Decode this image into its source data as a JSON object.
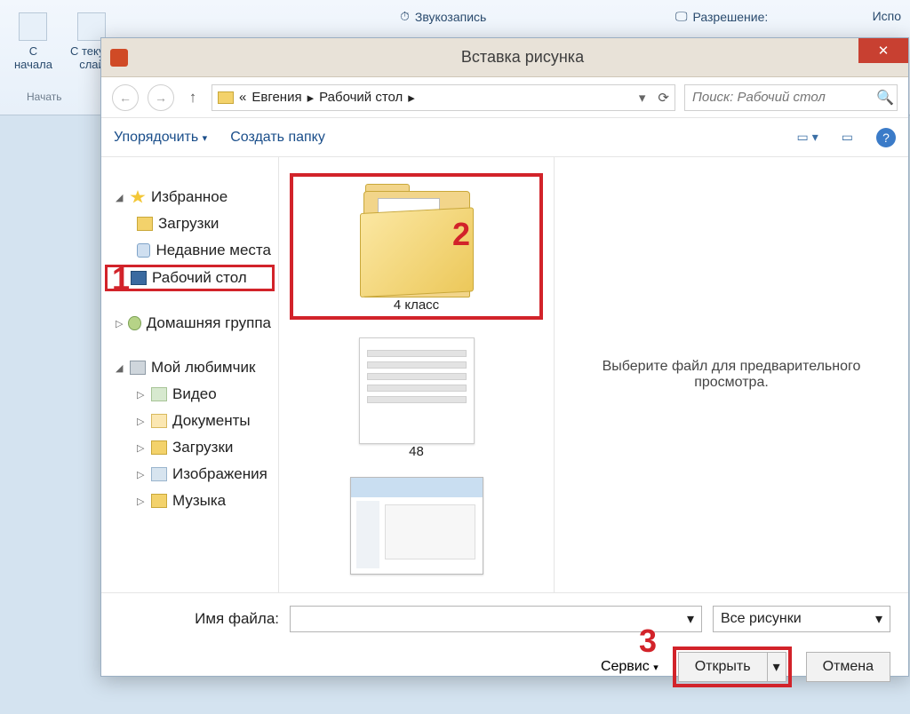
{
  "ribbon": {
    "btn1_top": "С",
    "btn1_bot": "начала",
    "btn2_top": "С текущ",
    "btn2_bot": "слай",
    "group1": "Начать",
    "sound": "Звукозапись",
    "resolution": "Разрешение:",
    "use": "Испо"
  },
  "dialog": {
    "title": "Вставка рисунка",
    "close": "✕",
    "nav": {
      "back": "←",
      "fwd": "→",
      "up": "↑",
      "sep": "▸"
    },
    "breadcrumb": {
      "prefix": "«",
      "p1": "Евгения",
      "p2": "Рабочий стол"
    },
    "refresh": "⟳",
    "search_placeholder": "Поиск: Рабочий стол",
    "organize": "Упорядочить",
    "newfolder": "Создать папку",
    "view_drop": "▾",
    "help": "?"
  },
  "sidebar": {
    "fav": "Избранное",
    "downloads": "Загрузки",
    "recent": "Недавние места",
    "desktop": "Рабочий стол",
    "homegroup": "Домашняя группа",
    "mypc": "Мой любимчик",
    "video": "Видео",
    "docs": "Документы",
    "downloads2": "Загрузки",
    "images": "Изображения",
    "music": "Музыка"
  },
  "items": {
    "folder1": "4 класс",
    "doc1": "48"
  },
  "preview": {
    "text": "Выберите файл для предварительного просмотра."
  },
  "footer": {
    "filename_lbl": "Имя файла:",
    "filter": "Все рисунки",
    "service": "Сервис",
    "open": "Открыть",
    "cancel": "Отмена"
  },
  "annot": {
    "a1": "1",
    "a2": "2",
    "a3": "3"
  }
}
